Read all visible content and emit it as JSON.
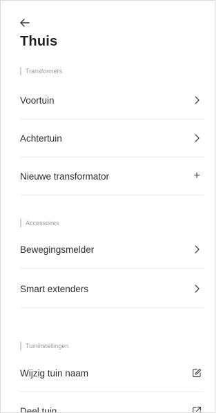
{
  "header": {
    "back_icon": "arrow-left-icon",
    "title": "Thuis"
  },
  "sections": {
    "transformers": {
      "header": "Transformers",
      "items": [
        {
          "label": "Voortuin",
          "icon": "chevron-right-icon"
        },
        {
          "label": "Achtertuin",
          "icon": "chevron-right-icon"
        },
        {
          "label": "Nieuwe transformator",
          "icon": "plus-icon",
          "glyph": "+"
        }
      ]
    },
    "accessoires": {
      "header": "Accessoires",
      "items": [
        {
          "label": "Bewegingsmelder",
          "icon": "chevron-right-icon"
        },
        {
          "label": "Smart extenders",
          "icon": "chevron-right-icon"
        }
      ]
    },
    "tuininstellingen": {
      "header": "Tuininstellingen",
      "items": [
        {
          "label": "Wijzig tuin naam",
          "icon": "edit-icon"
        },
        {
          "label": "Deel tuin",
          "icon": "share-icon"
        }
      ]
    }
  },
  "colors": {
    "text": "#2e2e2e",
    "section_text": "#9a9a9a",
    "divider": "#efefef"
  }
}
